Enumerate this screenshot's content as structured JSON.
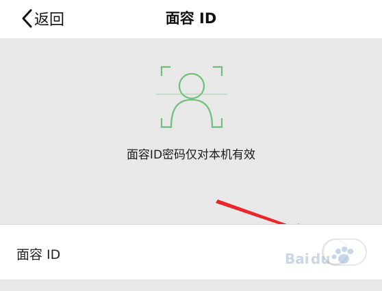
{
  "nav": {
    "back_label": "返回",
    "title": "面容 ID"
  },
  "hero": {
    "icon": "face-id-icon",
    "description": "面容ID密码仅对本机有效"
  },
  "settings": {
    "face_id_label": "面容 ID",
    "face_id_enabled": false
  },
  "colors": {
    "accent_green": "#6fbf7a",
    "arrow_red": "#e8262c",
    "nav_background": "#ffffff",
    "page_background": "#e8e8e8"
  }
}
